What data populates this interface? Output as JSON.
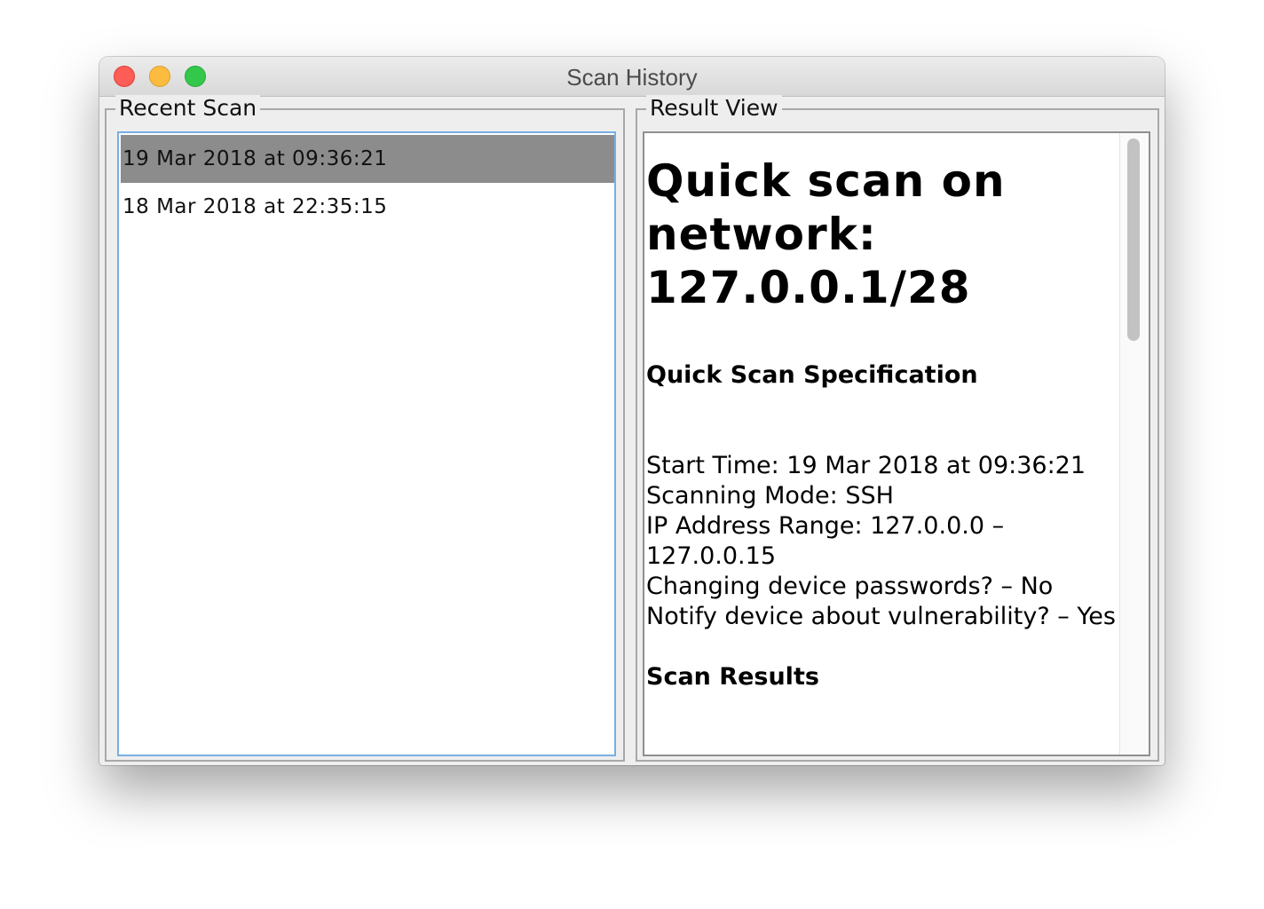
{
  "window": {
    "title": "Scan History"
  },
  "recent_scan": {
    "legend": "Recent Scan",
    "items": [
      {
        "label": "19 Mar 2018 at 09:36:21",
        "selected": true
      },
      {
        "label": "18 Mar 2018 at 22:35:15",
        "selected": false
      }
    ]
  },
  "result_view": {
    "legend": "Result View",
    "heading": "Quick scan on network: 127.0.0.1/28",
    "spec_heading": "Quick Scan Specification",
    "spec_lines": [
      "Start Time: 19 Mar 2018 at 09:36:21",
      "Scanning Mode: SSH",
      "IP Address Range: 127.0.0.0 – 127.0.0.15",
      "Changing device passwords? – No",
      "Notify device about vulnerability? – Yes"
    ],
    "results_heading": "Scan Results"
  },
  "colors": {
    "selection": "#8c8c8c",
    "focus_border": "#78aee3",
    "close": "#fc5d57",
    "minimize": "#fdbc40",
    "zoom": "#34c84a"
  },
  "icons": [
    "close-icon",
    "minimize-icon",
    "zoom-icon"
  ]
}
